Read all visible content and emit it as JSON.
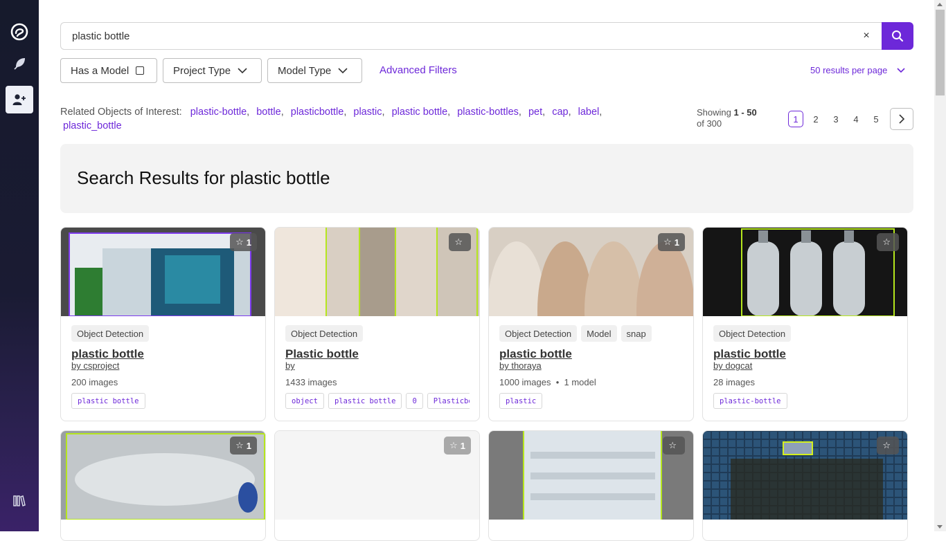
{
  "search": {
    "query": "plastic bottle",
    "clear_label": "×"
  },
  "filters": {
    "has_model": "Has a Model",
    "project_type": "Project Type",
    "model_type": "Model Type",
    "advanced": "Advanced Filters",
    "per_page": "50 results per page"
  },
  "related": {
    "label": "Related Objects of Interest:",
    "items": [
      "plastic-bottle",
      "bottle",
      "plasticbottle",
      "plastic",
      "plastic bottle",
      "plastic-bottles",
      "pet",
      "cap",
      "label",
      "plastic_bottle"
    ]
  },
  "pagination": {
    "showing_prefix": "Showing",
    "range": "1 - 50",
    "of_total": "of 300",
    "pages": [
      "1",
      "2",
      "3",
      "4",
      "5"
    ],
    "active_page": "1"
  },
  "heading": "Search Results for plastic bottle",
  "cards": [
    {
      "stars": "1",
      "badges": [
        "Object Detection"
      ],
      "title": "plastic bottle",
      "by": "by csproject",
      "count": "200 images",
      "tags": [
        "plastic bottle"
      ]
    },
    {
      "stars": "",
      "badges": [
        "Object Detection"
      ],
      "title": "Plastic bottle",
      "by": "by",
      "count": "1433 images",
      "tags": [
        "object",
        "plastic bottle",
        "0",
        "Plasticbottle"
      ]
    },
    {
      "stars": "1",
      "badges": [
        "Object Detection",
        "Model",
        "snap"
      ],
      "title": "plastic bottle",
      "by": "by thoraya",
      "count": "1000 images",
      "models": "1 model",
      "tags": [
        "plastic"
      ]
    },
    {
      "stars": "",
      "badges": [
        "Object Detection"
      ],
      "title": "plastic bottle",
      "by": "by dogcat",
      "count": "28 images",
      "tags": [
        "plastic-bottle"
      ]
    },
    {
      "stars": "1"
    },
    {
      "stars": "1"
    },
    {
      "stars": ""
    },
    {
      "stars": ""
    }
  ],
  "colors": {
    "accent": "#6d28d9",
    "sidebar": "#161a2c"
  }
}
